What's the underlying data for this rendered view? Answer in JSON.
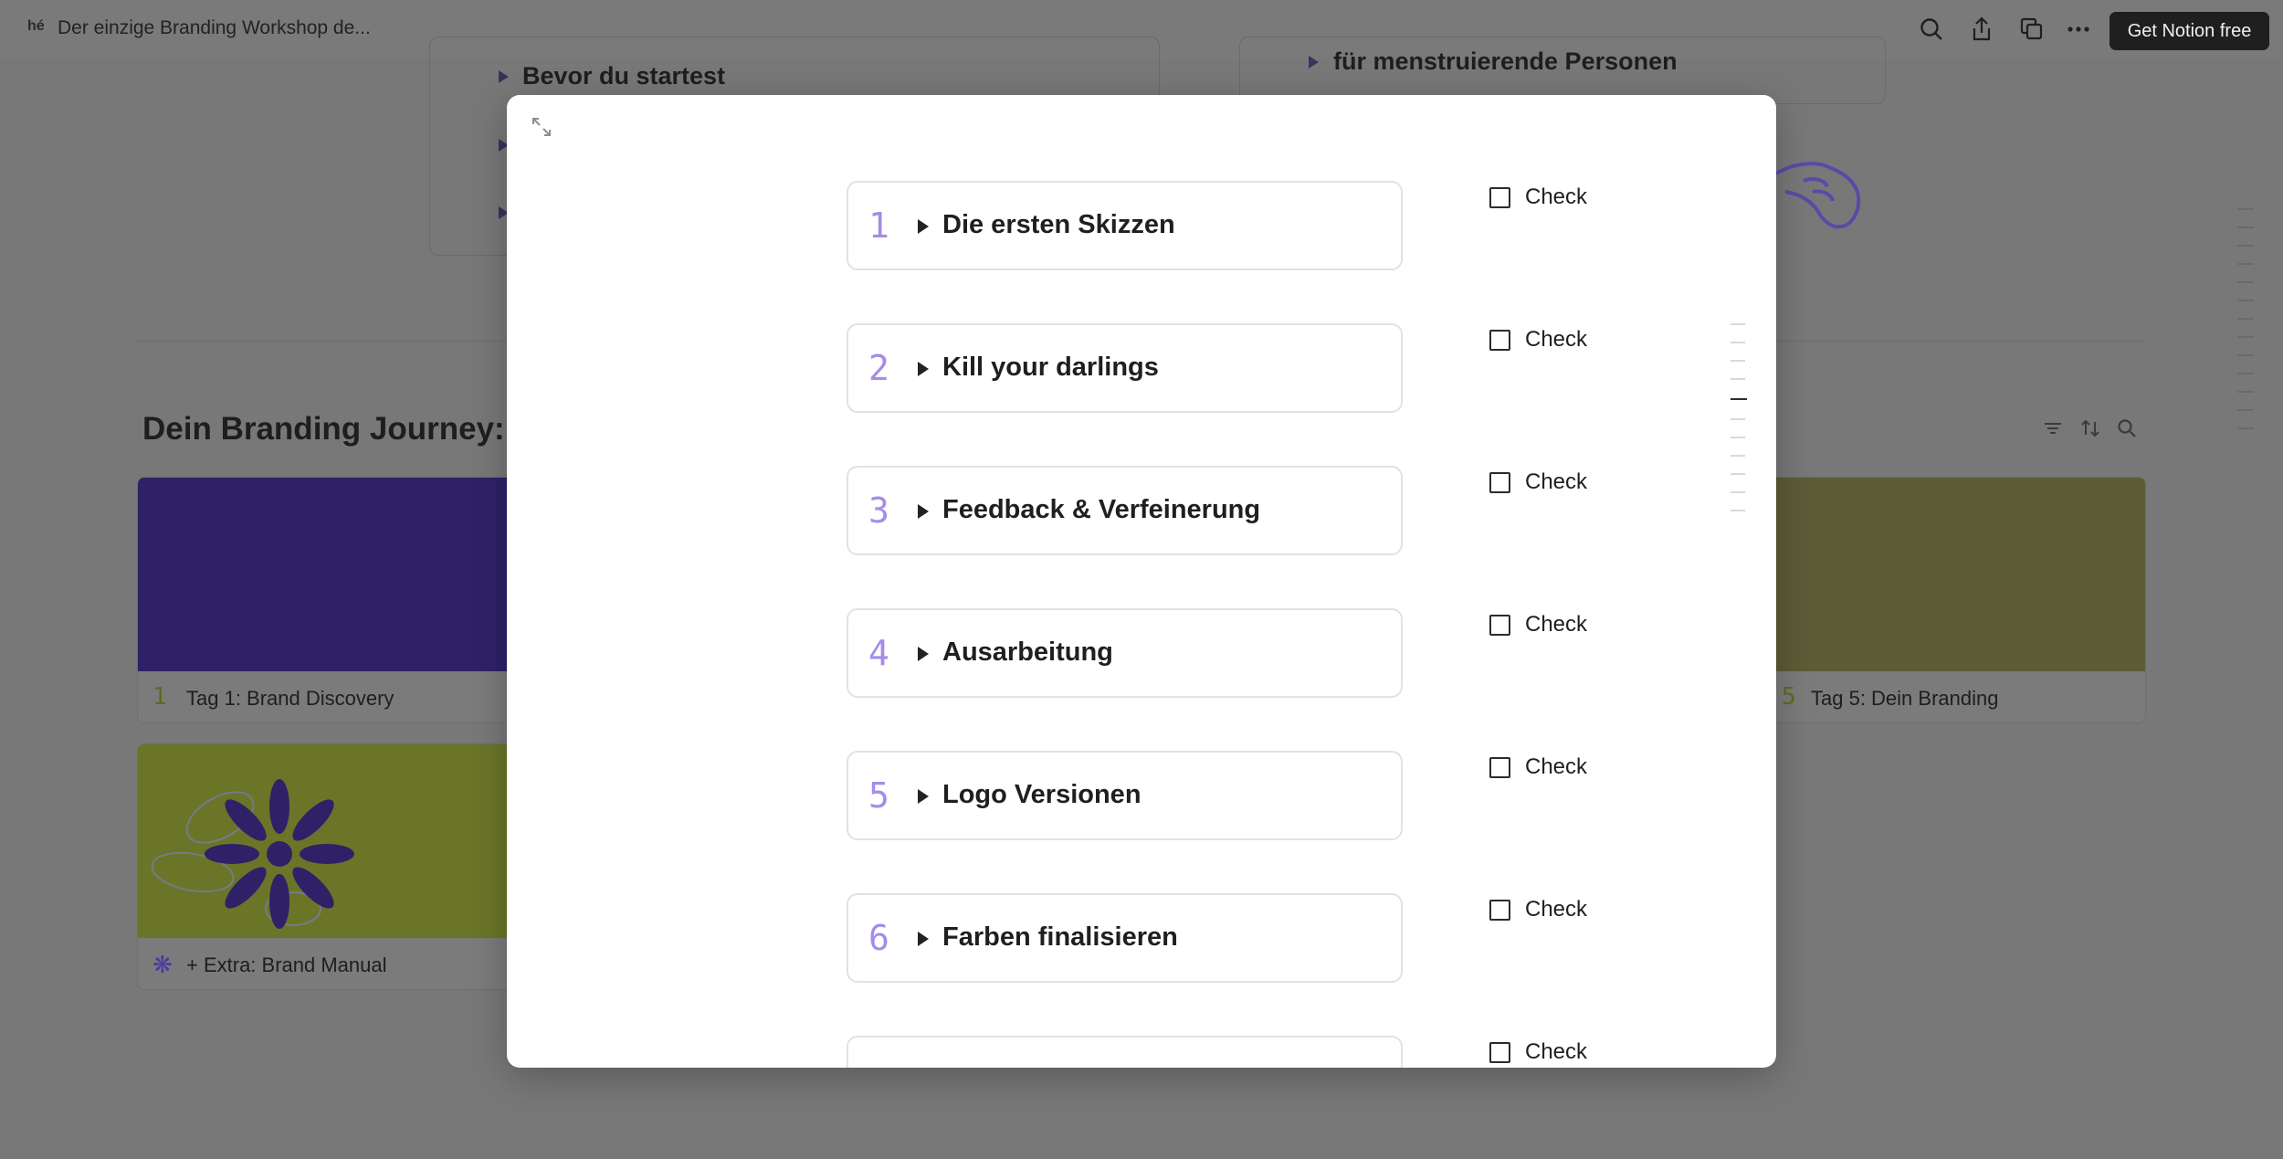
{
  "topbar": {
    "title": "Der einzige Branding Workshop de...",
    "favicon": "hé",
    "icons": [
      "search-icon",
      "share-icon",
      "duplicate-icon",
      "more-icon"
    ],
    "cta_label": "Get Notion free"
  },
  "background": {
    "toggles_left": [
      "Bevor du startest"
    ],
    "toggles_right": [
      "für menstruierende Personen"
    ],
    "journey_title": "Dein Branding Journey:",
    "view_icons": [
      "filter-icon",
      "sort-icon",
      "search-icon"
    ],
    "cards": [
      {
        "num": "1",
        "label": "Tag 1: Brand Discovery",
        "cover_color": "#2f2168"
      },
      {
        "num": "5",
        "label": "Tag 5: Dein Branding",
        "cover_color": "#5c5c37"
      },
      {
        "num": "",
        "label": "+ Extra: Brand Manual",
        "cover_color": "#6b7528"
      }
    ]
  },
  "modal": {
    "expand_icon": "expand-icon",
    "steps": [
      {
        "num": "1",
        "label": "Die ersten Skizzen",
        "check": "Check",
        "checked": false
      },
      {
        "num": "2",
        "label": "Kill your darlings",
        "check": "Check",
        "checked": false
      },
      {
        "num": "3",
        "label": "Feedback & Verfeinerung",
        "check": "Check",
        "checked": false
      },
      {
        "num": "4",
        "label": "Ausarbeitung",
        "check": "Check",
        "checked": false
      },
      {
        "num": "5",
        "label": "Logo Versionen",
        "check": "Check",
        "checked": false
      },
      {
        "num": "6",
        "label": "Farben finalisieren",
        "check": "Check",
        "checked": false
      },
      {
        "num": "",
        "label": "",
        "check": "Check",
        "checked": false
      }
    ]
  },
  "colors": {
    "accent_number": "#a58bea",
    "overlay": "#787878",
    "button_dark": "#1f1f1f"
  }
}
